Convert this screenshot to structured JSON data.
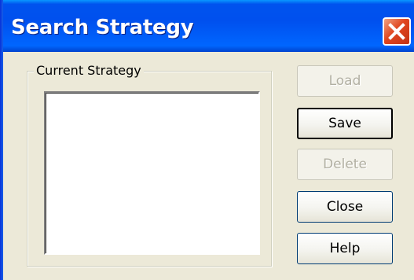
{
  "window": {
    "title": "Search Strategy",
    "close_icon": "close-x-icon"
  },
  "group": {
    "label": "Current Strategy",
    "list_items": []
  },
  "buttons": {
    "load": "Load",
    "save": "Save",
    "delete": "Delete",
    "close": "Close",
    "help": "Help"
  },
  "colors": {
    "titlebar": "#0054e3",
    "dialog_bg": "#ece9d8",
    "close_button": "#e0461f"
  }
}
